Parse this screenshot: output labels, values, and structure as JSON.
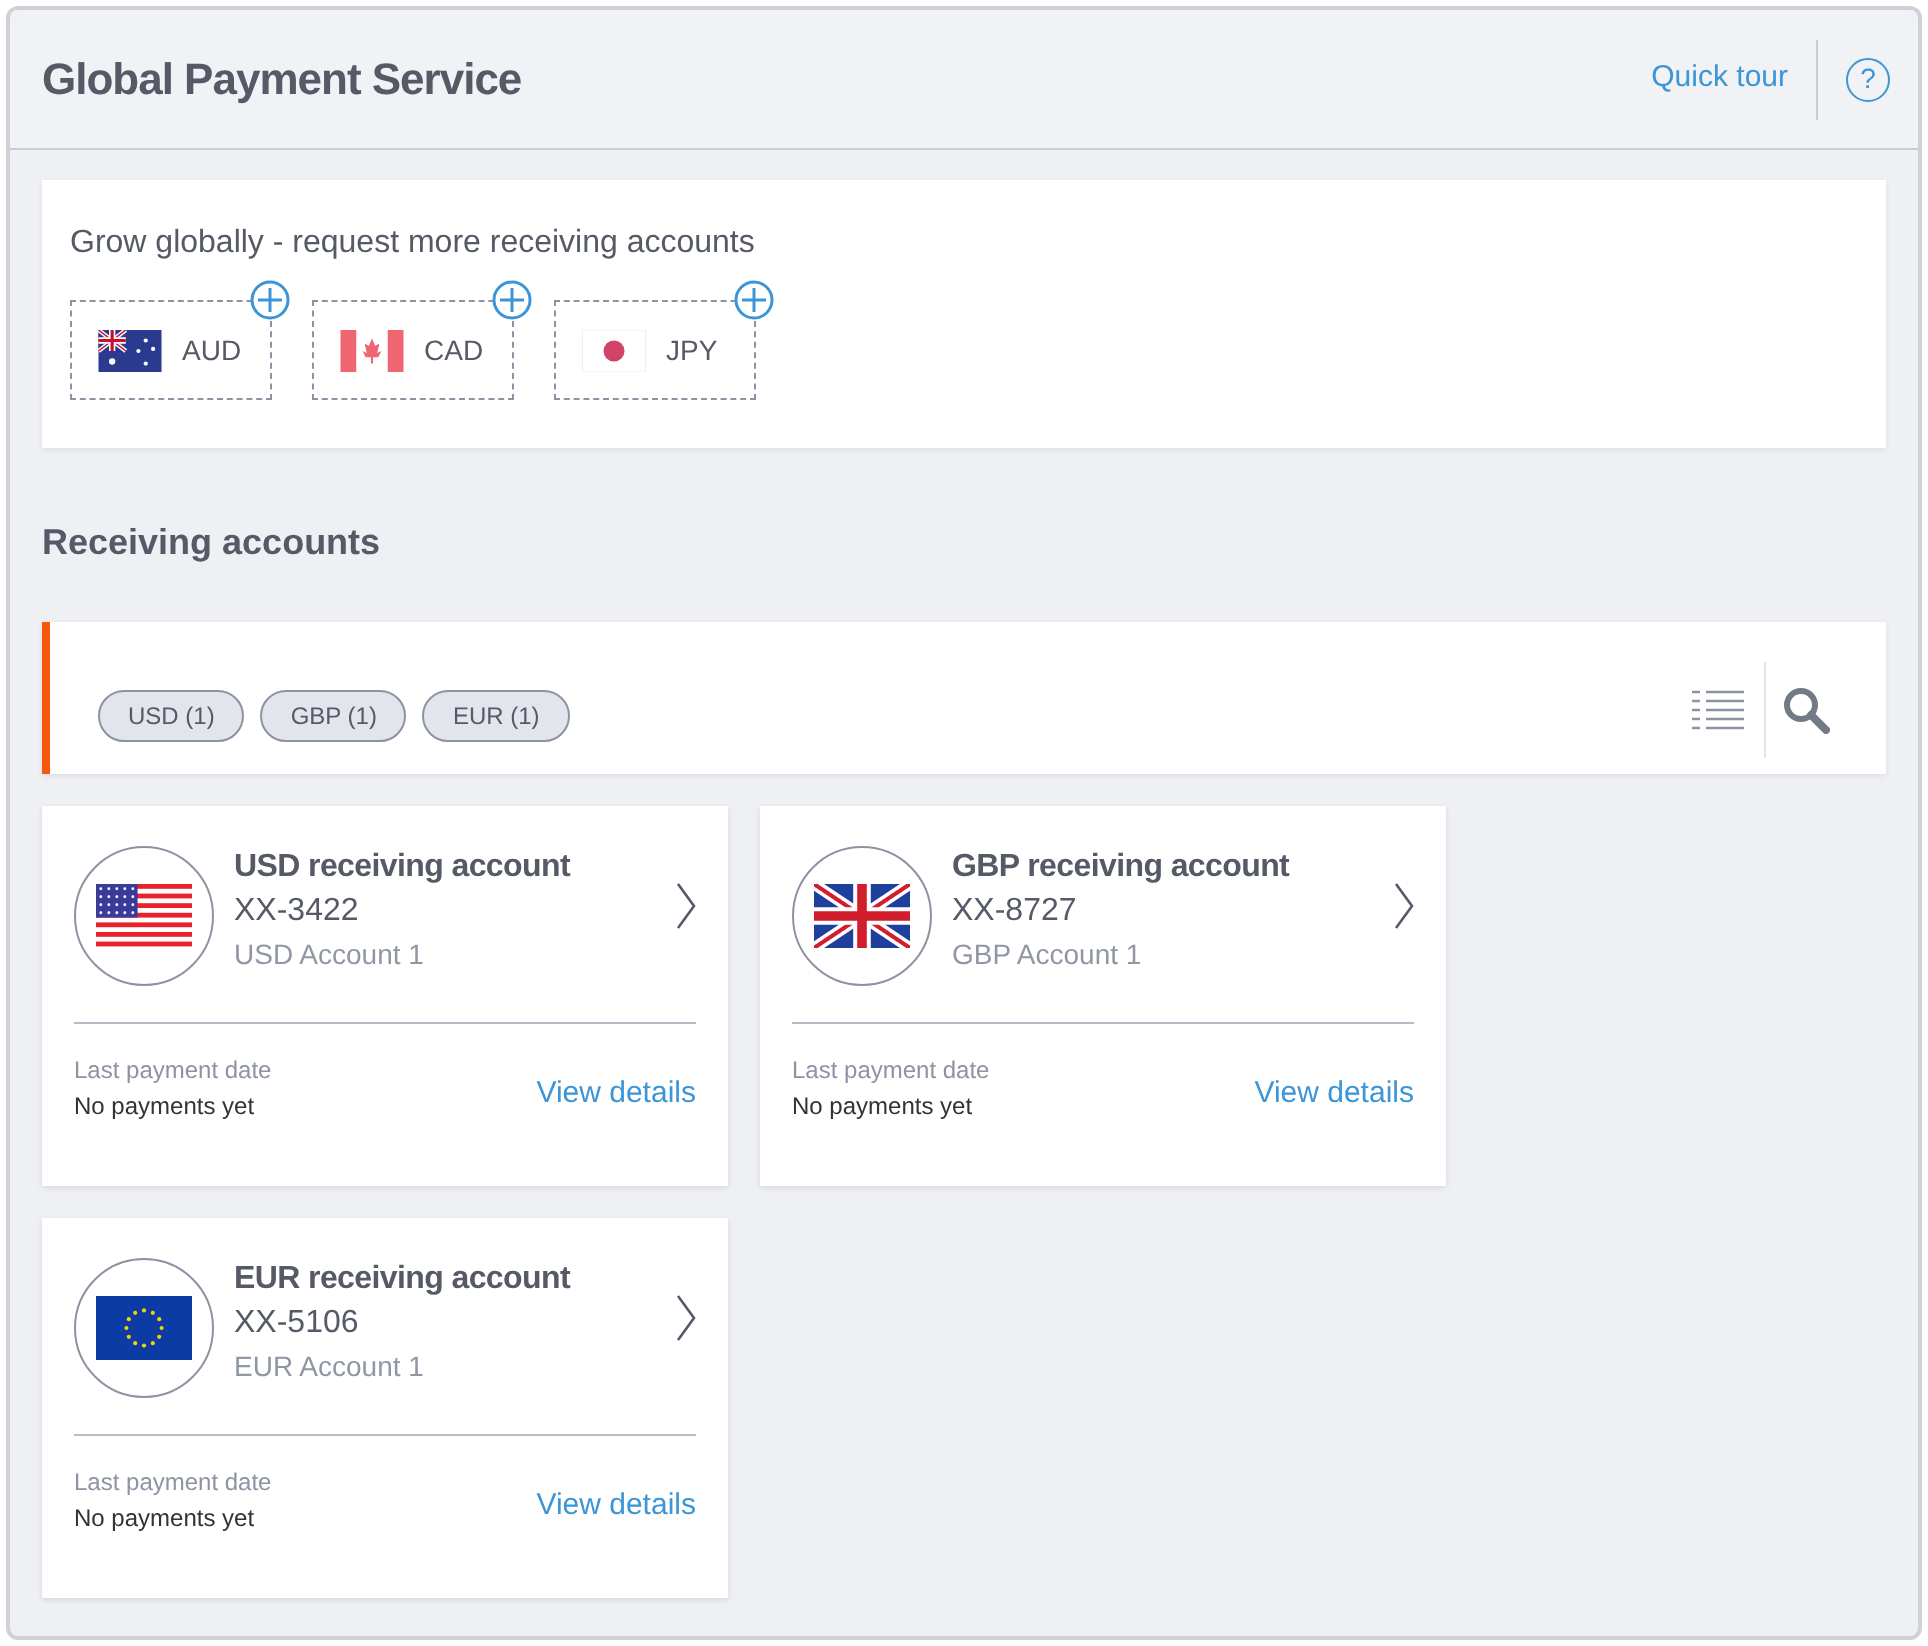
{
  "header": {
    "title": "Global Payment Service",
    "quick_tour": "Quick tour",
    "help": "?"
  },
  "promo": {
    "text": "Grow globally - request more receiving accounts",
    "currencies": [
      {
        "kind": "au",
        "code": "AUD"
      },
      {
        "kind": "ca",
        "code": "CAD"
      },
      {
        "kind": "jp",
        "code": "JPY"
      }
    ]
  },
  "section_title": "Receiving accounts",
  "filters": [
    {
      "label": "USD (1)"
    },
    {
      "label": "GBP (1)"
    },
    {
      "label": "EUR (1)"
    }
  ],
  "accounts": [
    {
      "kind": "us",
      "title": "USD receiving account",
      "number": "XX-3422",
      "name": "USD Account 1",
      "last_label": "Last payment date",
      "last_value": "No payments yet",
      "link": "View details"
    },
    {
      "kind": "gb",
      "title": "GBP receiving account",
      "number": "XX-8727",
      "name": "GBP Account 1",
      "last_label": "Last payment date",
      "last_value": "No payments yet",
      "link": "View details"
    },
    {
      "kind": "eu",
      "title": "EUR receiving account",
      "number": "XX-5106",
      "name": "EUR Account 1",
      "last_label": "Last payment date",
      "last_value": "No payments yet",
      "link": "View details"
    }
  ]
}
